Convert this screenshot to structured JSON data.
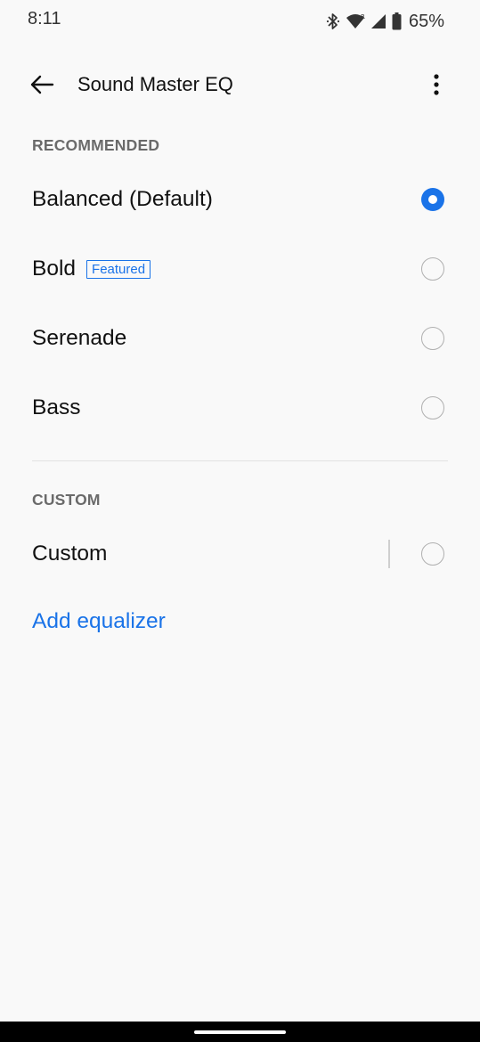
{
  "status_bar": {
    "time": "8:11",
    "battery": "65%",
    "icons": [
      "bluetooth-icon",
      "wifi-icon",
      "signal-icon",
      "battery-icon"
    ]
  },
  "app_bar": {
    "title": "Sound Master EQ",
    "back_icon": "arrow-back-icon",
    "more_icon": "more-vert-icon"
  },
  "recommended": {
    "header": "RECOMMENDED",
    "options": [
      {
        "label": "Balanced (Default)",
        "selected": true
      },
      {
        "label": "Bold",
        "badge": "Featured",
        "selected": false
      },
      {
        "label": "Serenade",
        "selected": false
      },
      {
        "label": "Bass",
        "selected": false
      }
    ]
  },
  "custom": {
    "header": "CUSTOM",
    "options": [
      {
        "label": "Custom",
        "selected": false
      }
    ],
    "add_link": "Add equalizer"
  },
  "colors": {
    "accent": "#1a73e8",
    "background": "#f9f9f9",
    "header_text": "#6a6a6a"
  }
}
